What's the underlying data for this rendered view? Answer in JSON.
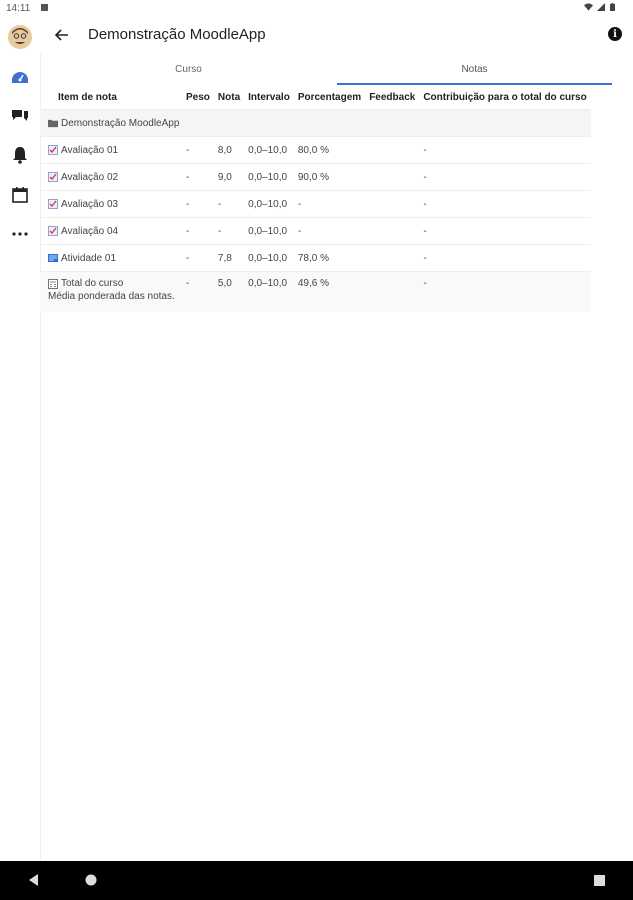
{
  "status": {
    "time": "14:11"
  },
  "header": {
    "title": "Demonstração MoodleApp"
  },
  "tabs": [
    {
      "label": "Curso",
      "active": false
    },
    {
      "label": "Notas",
      "active": true
    }
  ],
  "table": {
    "headers": [
      "Item de nota",
      "Peso",
      "Nota",
      "Intervalo",
      "Porcentagem",
      "Feedback",
      "Contribuição para o total do curso"
    ],
    "category": "Demonstração MoodleApp",
    "rows": [
      {
        "item": "Avaliação 01",
        "icon": "quiz-icon",
        "peso": "-",
        "nota": "8,0",
        "intervalo": "0,0–10,0",
        "porcentagem": "80,0 %",
        "feedback": "",
        "contribuicao": "-"
      },
      {
        "item": "Avaliação 02",
        "icon": "quiz-icon",
        "peso": "-",
        "nota": "9,0",
        "intervalo": "0,0–10,0",
        "porcentagem": "90,0 %",
        "feedback": "",
        "contribuicao": "-"
      },
      {
        "item": "Avaliação 03",
        "icon": "quiz-icon",
        "peso": "-",
        "nota": "-",
        "intervalo": "0,0–10,0",
        "porcentagem": "-",
        "feedback": "",
        "contribuicao": "-"
      },
      {
        "item": "Avaliação 04",
        "icon": "quiz-icon",
        "peso": "-",
        "nota": "-",
        "intervalo": "0,0–10,0",
        "porcentagem": "-",
        "feedback": "",
        "contribuicao": "-"
      },
      {
        "item": "Atividade 01",
        "icon": "assignment-icon",
        "peso": "-",
        "nota": "7,8",
        "intervalo": "0,0–10,0",
        "porcentagem": "78,0 %",
        "feedback": "",
        "contribuicao": "-"
      }
    ],
    "total": {
      "item": "Total do curso",
      "subtitle": "Média ponderada das notas.",
      "peso": "-",
      "nota": "5,0",
      "intervalo": "0,0–10,0",
      "porcentagem": "49,6 %",
      "feedback": "",
      "contribuicao": "-"
    }
  },
  "colors": {
    "accent": "#3f6fcf",
    "sidebar_active": "#3f6fcf"
  }
}
